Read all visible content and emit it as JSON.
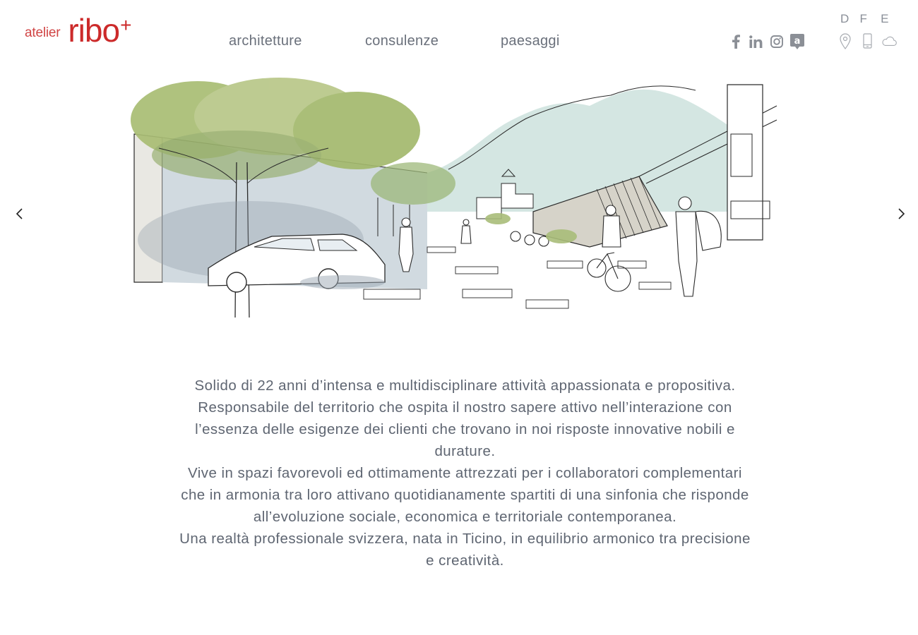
{
  "brand": {
    "prefix": "atelier",
    "name": "ribo",
    "suffix": "+",
    "color": "#cc2a2a"
  },
  "nav": {
    "items": [
      {
        "label": "architetture"
      },
      {
        "label": "consulenze"
      },
      {
        "label": "paesaggi"
      }
    ]
  },
  "social": {
    "icons": [
      "facebook-icon",
      "linkedin-icon",
      "instagram-icon",
      "archilovers-icon"
    ]
  },
  "languages": [
    "D",
    "F",
    "E"
  ],
  "contact": {
    "icons": [
      "location-pin-icon",
      "phone-icon",
      "cloud-icon"
    ]
  },
  "slider": {
    "prev_icon": "chevron-left-icon",
    "next_icon": "chevron-right-icon",
    "image_icon": "street-sketch-illustration"
  },
  "intro": {
    "paragraphs": [
      "Solido di 22 anni d’intensa e multidisciplinare attività appassionata e propositiva. Responsabile del territorio che ospita il nostro sapere attivo nell’interazione con l’essenza delle esigenze dei clienti che trovano in noi risposte innovative nobili e durature.",
      "Vive in spazi favorevoli ed ottimamente attrezzati per i collaboratori complementari che in armonia tra loro attivano quotidianamente spartiti di una sinfonia che risponde all’evoluzione sociale, economica e territoriale contemporanea.",
      "Una realtà professionale svizzera, nata in Ticino, in equilibrio armonico tra precisione e creatività."
    ]
  }
}
